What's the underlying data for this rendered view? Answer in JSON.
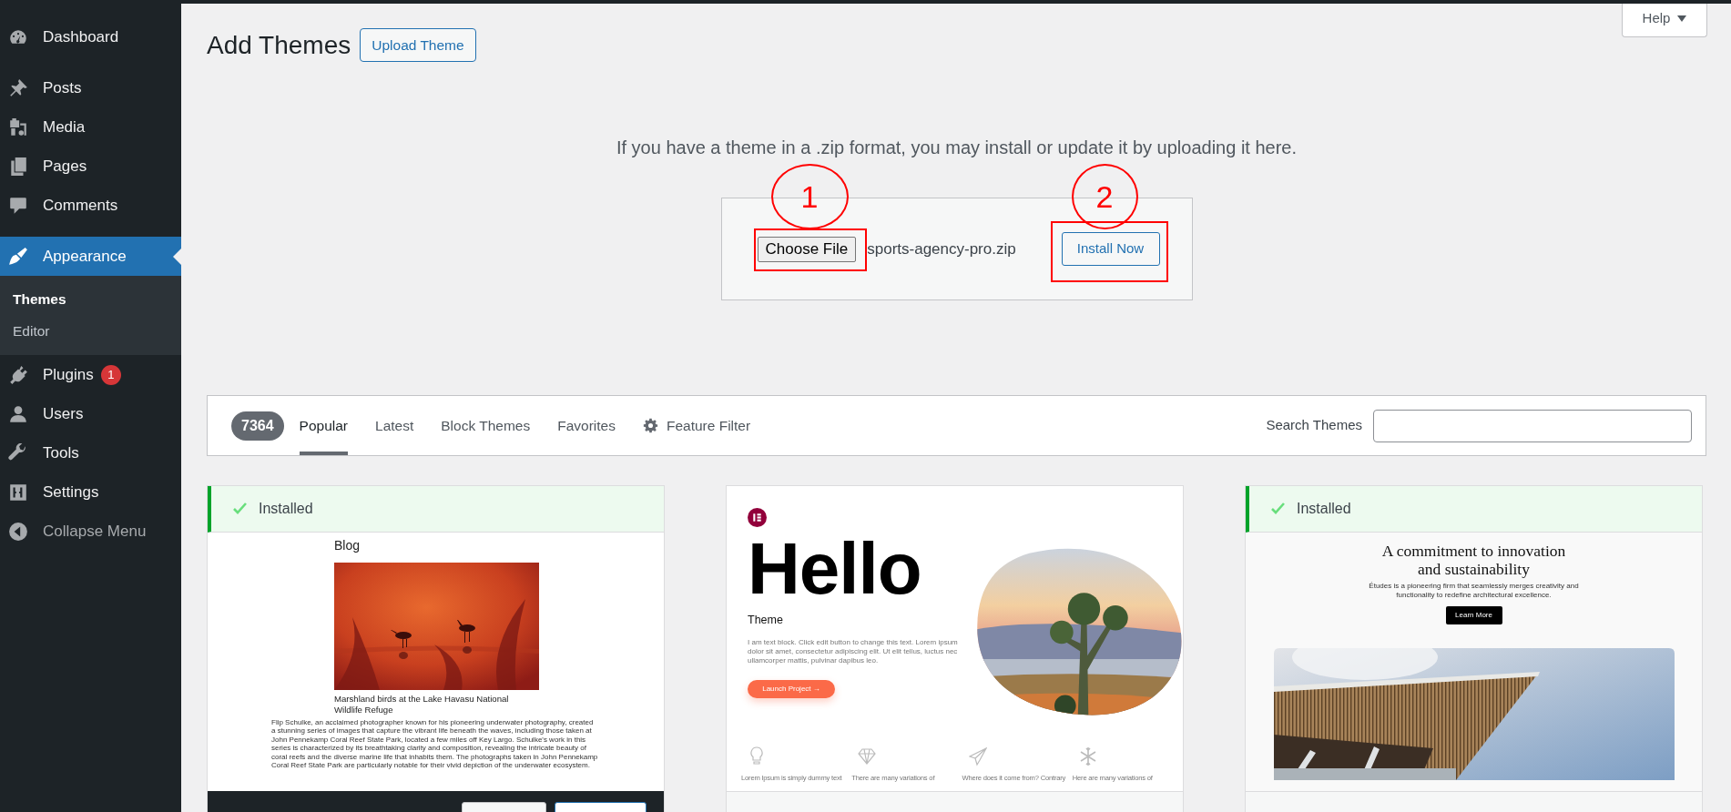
{
  "sidebar": {
    "groups": [
      {
        "items": [
          {
            "label": "Dashboard",
            "selected": false
          }
        ]
      },
      {
        "items": [
          {
            "label": "Posts",
            "selected": false
          },
          {
            "label": "Media",
            "selected": false
          },
          {
            "label": "Pages",
            "selected": false
          },
          {
            "label": "Comments",
            "selected": false
          }
        ]
      },
      {
        "items": [
          {
            "label": "Appearance",
            "selected": true,
            "expanded": true,
            "children": [
              {
                "label": "Themes",
                "selected": true
              },
              {
                "label": "Editor",
                "selected": false
              }
            ]
          },
          {
            "label": "Plugins",
            "selected": false,
            "badge": "1"
          },
          {
            "label": "Users",
            "selected": false
          },
          {
            "label": "Tools",
            "selected": false
          },
          {
            "label": "Settings",
            "selected": false
          }
        ]
      }
    ],
    "collapse_menu": "Collapse Menu"
  },
  "help_button": "Help",
  "page_title": "Add Themes",
  "upload_theme_button": "Upload Theme",
  "upload": {
    "instructions": "If you have a theme in a .zip format, you may install or update it by uploading it here.",
    "file_button": "Choose File",
    "file_name": "sports-agency-pro.zip",
    "install_button": "Install Now"
  },
  "annotations": [
    {
      "label": "1"
    },
    {
      "label": "2"
    }
  ],
  "filter_bar": {
    "count": "7364",
    "tabs": [
      {
        "label": "Popular",
        "selected": true
      },
      {
        "label": "Latest",
        "selected": false
      },
      {
        "label": "Block Themes",
        "selected": false
      },
      {
        "label": "Favorites",
        "selected": false
      },
      {
        "label": "Feature Filter",
        "selected": false,
        "kind": "filter"
      }
    ],
    "search_label": "Search Themes"
  },
  "themes": [
    {
      "installed": true,
      "status": "Installed",
      "hovered": true,
      "preview": {
        "kind": "blog",
        "heading": "Blog",
        "title": "Marshland birds at the Lake Havasu National Wildlife Refuge",
        "text": "Flip Schulke, an acclaimed photographer known for his pioneering underwater photography, created a stunning series of images that capture the vibrant life beneath the waves, including those taken at John Pennekamp Coral Reef State Park, located a few miles off Key Largo. Schulke's work in this series is characterized by its breathtaking clarity and composition, revealing the intricate beauty of coral reefs and the diverse marine life that inhabits them. The photographs taken in John Pennekamp Coral Reef State Park are particularly notable for their vivid depiction of the underwater ecosystem."
      }
    },
    {
      "installed": false,
      "hovered": false,
      "preview": {
        "kind": "landing",
        "headline": "Hello",
        "subtitle": "Theme",
        "text": "I am text block. Click edit button to change this text. Lorem ipsum dolor sit amet, consectetur adipiscing elit. Ut elit tellus, luctus nec ullamcorper mattis, pulvinar dapibus leo.",
        "button": "Launch Project →",
        "features": [
          "Lorem Ipsum is simply dummy text",
          "There are many variations of",
          "Where does it come from? Contrary",
          "Here are many variations of"
        ]
      }
    },
    {
      "installed": true,
      "status": "Installed",
      "hovered": false,
      "preview": {
        "kind": "studio",
        "heading": "A commitment to innovation and sustainability",
        "text": "Études is a pioneering firm that seamlessly merges creativity and functionality to redefine architectural excellence.",
        "button": "Learn More"
      }
    }
  ]
}
